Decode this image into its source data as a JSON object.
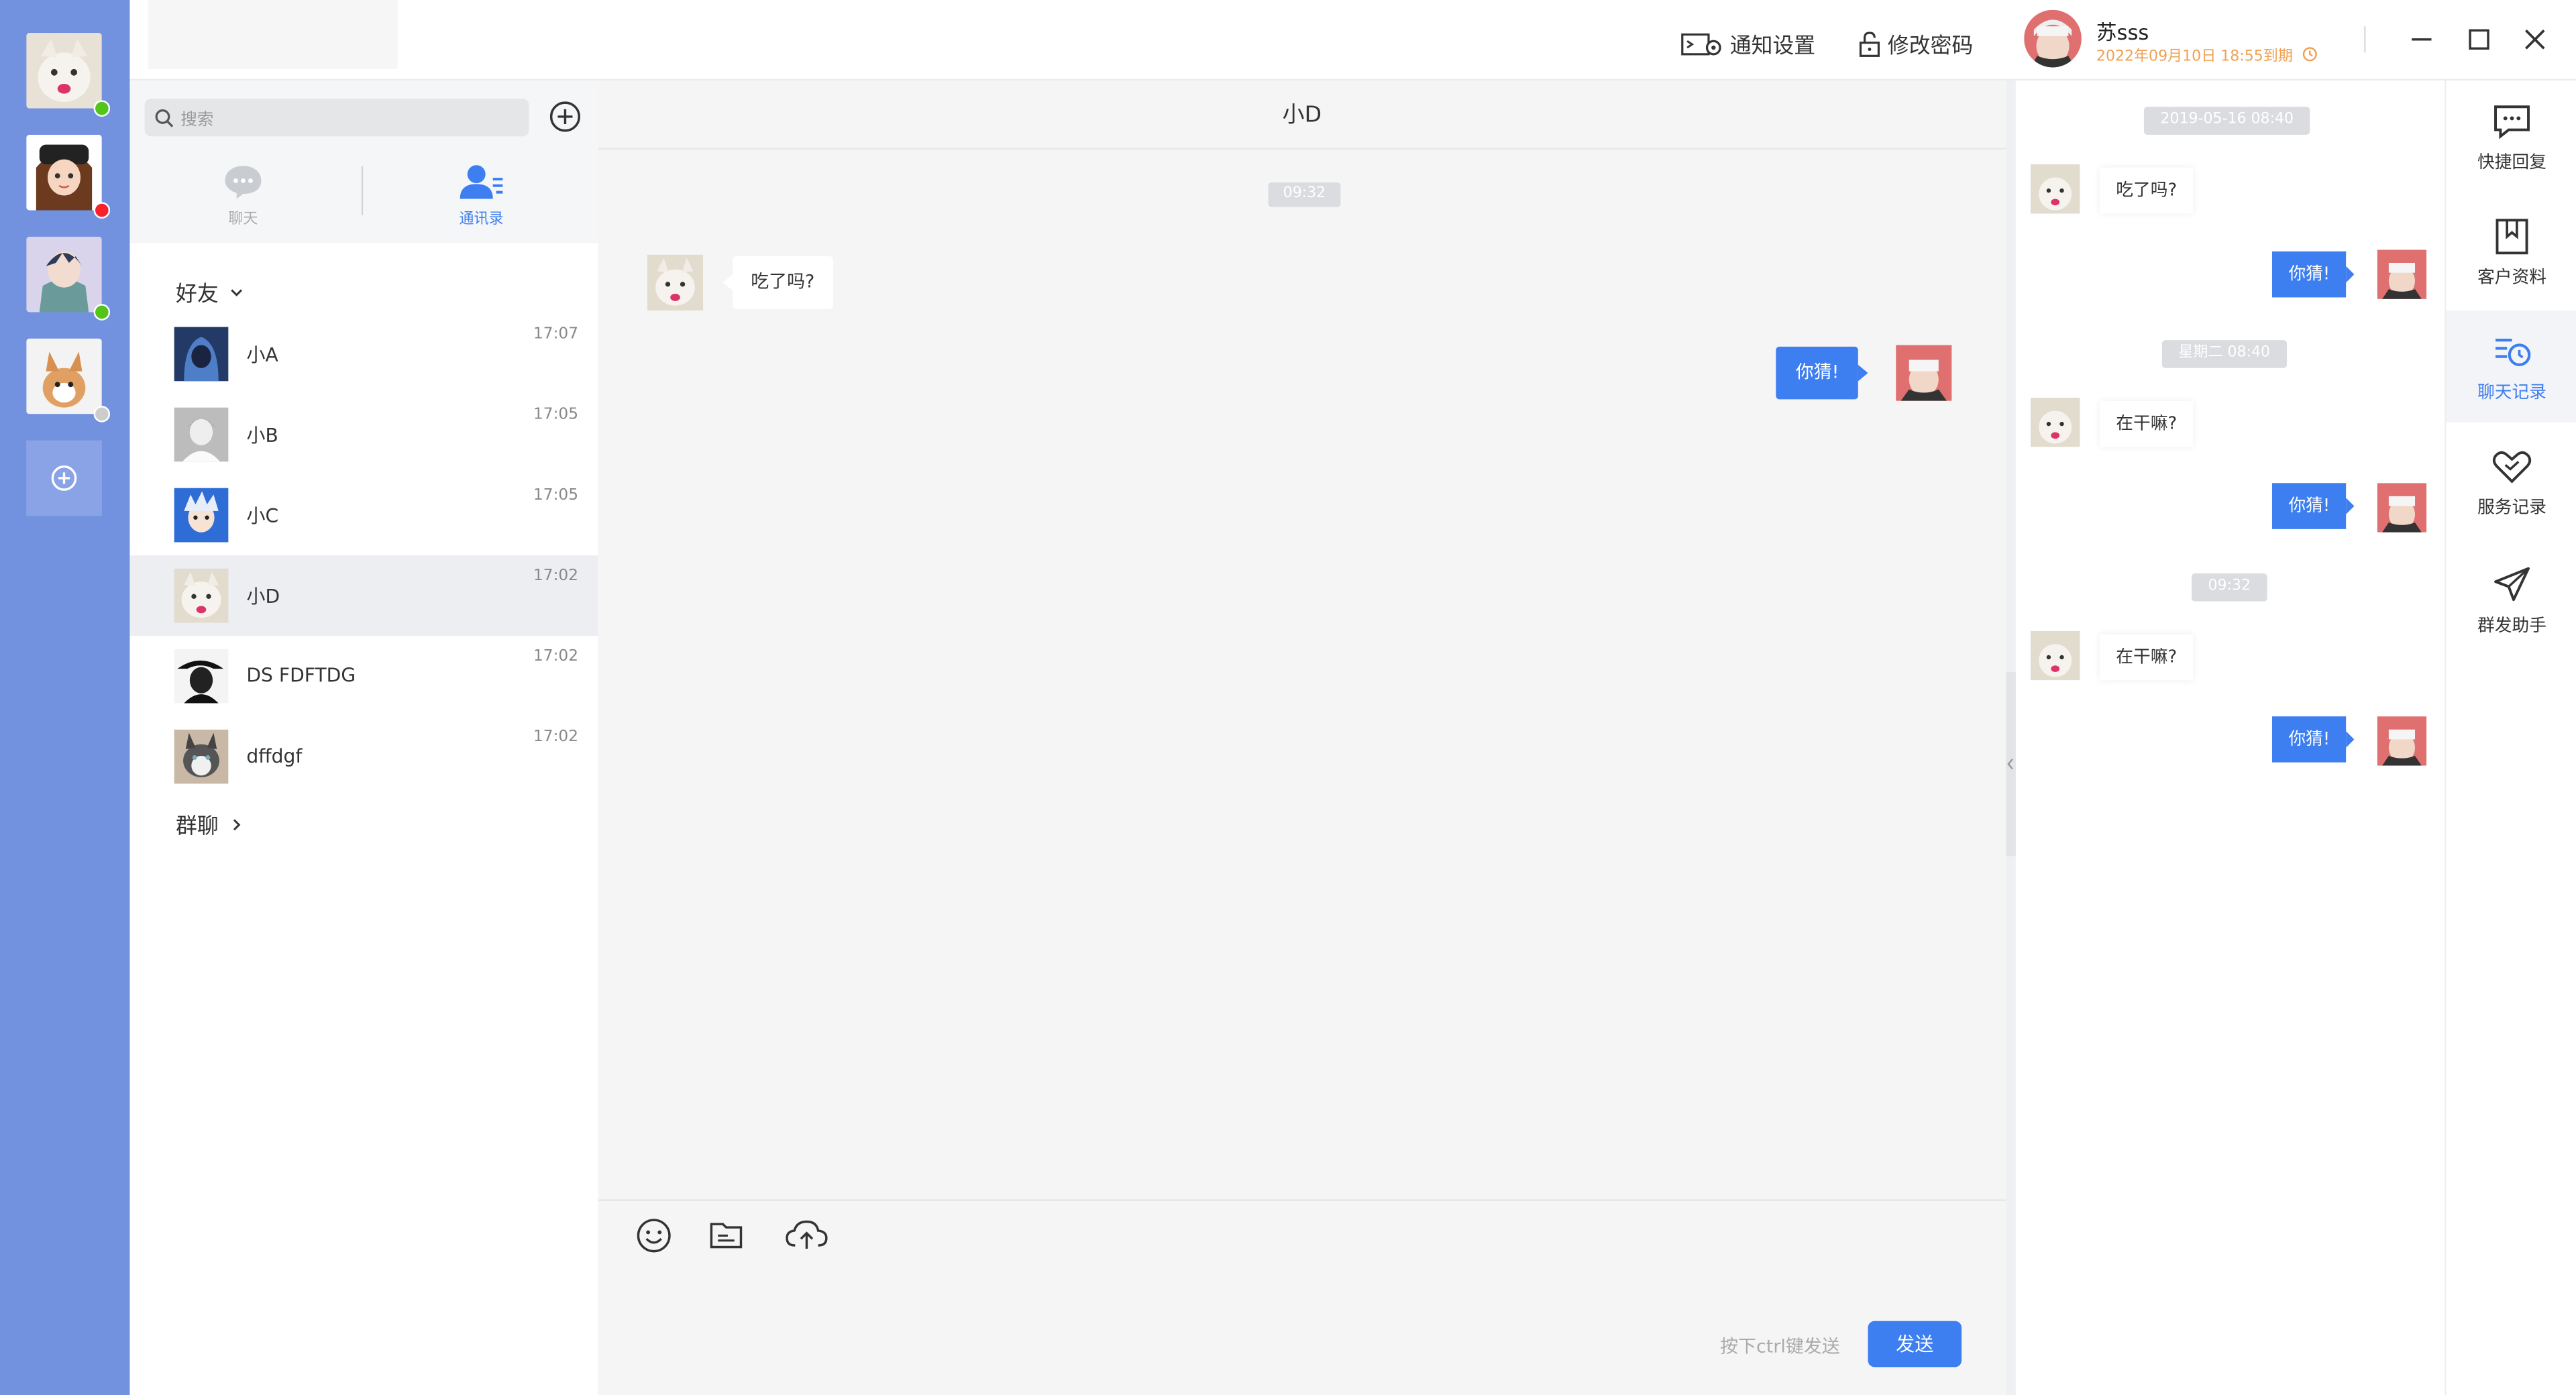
{
  "header": {
    "notify_settings": "通知设置",
    "change_password": "修改密码",
    "user_name": "苏sss",
    "expiry": "2022年09月10日 18:55到期"
  },
  "contacts": {
    "search_placeholder": "搜索",
    "tabs": [
      {
        "label": "聊天"
      },
      {
        "label": "通讯录"
      }
    ],
    "friends_group": "好友",
    "group_chats": "群聊",
    "items": [
      {
        "name": "小A",
        "time": "17:07"
      },
      {
        "name": "小B",
        "time": "17:05"
      },
      {
        "name": "小C",
        "time": "17:05"
      },
      {
        "name": "小D",
        "time": "17:02"
      },
      {
        "name": "DS FDFTDG",
        "time": "17:02"
      },
      {
        "name": "dffdgf",
        "time": "17:02"
      }
    ]
  },
  "chat": {
    "title": "小D",
    "time_pill": "09:32",
    "incoming": "吃了吗?",
    "outgoing": "你猜!",
    "hint": "按下ctrl键发送",
    "send": "发送"
  },
  "history": {
    "blocks": [
      {
        "time": "2019-05-16 08:40",
        "incoming": "吃了吗?",
        "outgoing": "你猜!"
      },
      {
        "time": "星期二 08:40",
        "incoming": "在干嘛?",
        "outgoing": "你猜!"
      },
      {
        "time": "09:32",
        "incoming": "在干嘛?",
        "outgoing": "你猜!"
      }
    ]
  },
  "rightbar": {
    "items": [
      {
        "label": "快捷回复"
      },
      {
        "label": "客户资料"
      },
      {
        "label": "聊天记录"
      },
      {
        "label": "服务记录"
      },
      {
        "label": "群发助手"
      }
    ]
  },
  "colors": {
    "accent": "#3d7ef0",
    "sidebar": "#7291de",
    "online": "#52c41a",
    "busy": "#f5222d",
    "expiry": "#f0a050"
  }
}
